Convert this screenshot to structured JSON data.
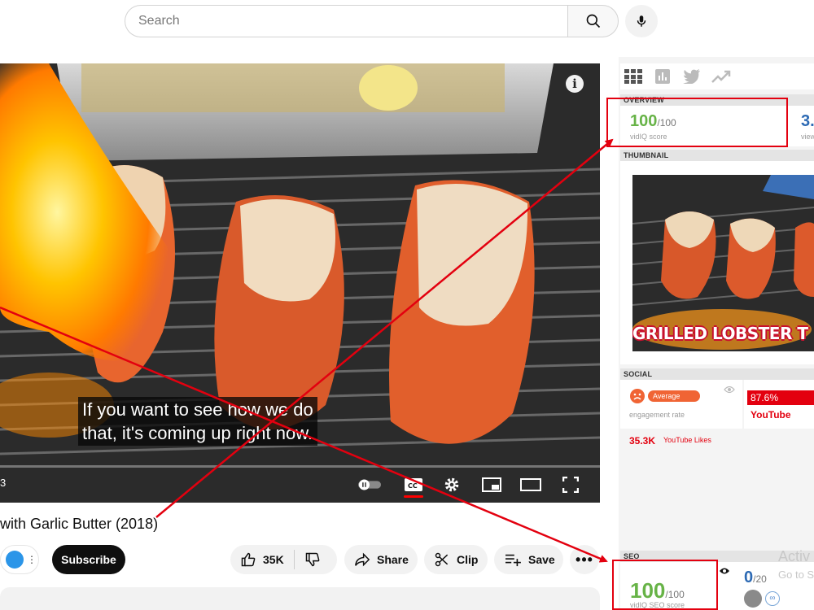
{
  "search": {
    "placeholder": "Search"
  },
  "player": {
    "caption_lines": [
      "If you want to see how we do",
      "that, it's coming up right now."
    ],
    "time_fragment": "3"
  },
  "video": {
    "title": "with Garlic Butter (2018)",
    "subscribe_label": "Subscribe",
    "likes": "35K",
    "share_label": "Share",
    "clip_label": "Clip",
    "save_label": "Save"
  },
  "vidiq": {
    "overview_label": "OVERVIEW",
    "score": "100",
    "score_denominator": "/100",
    "score_caption": "vidIQ score",
    "views_fragment": "3.",
    "views_caption_fragment": "view",
    "thumbnail_label": "THUMBNAIL",
    "thumbnail_text": "GRILLED LOBSTER T",
    "social_label": "SOCIAL",
    "engagement_badge": "Average",
    "engagement_caption": "engagement rate",
    "youtube_pct": "87.6%",
    "youtube_label": "YouTube",
    "likes_value": "35.3K",
    "likes_caption": "YouTube Likes",
    "seo_label": "SEO",
    "seo_score": "100",
    "seo_denominator": "/100",
    "seo_caption": "vidIQ SEO score",
    "seo_second_score": "0",
    "seo_second_denominator": "/20"
  },
  "watermark": {
    "line1": "Activ",
    "line2": "Go to S"
  },
  "colors": {
    "annotation_red": "#e3000f",
    "score_green": "#67b347",
    "subscribe_bg": "#0f0f0f",
    "engagement_orange": "#f06434"
  }
}
